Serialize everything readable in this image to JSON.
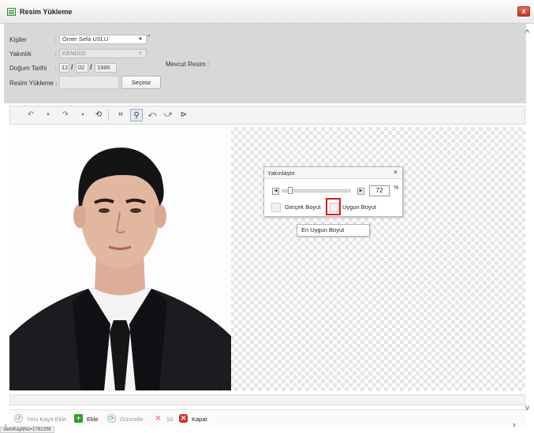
{
  "window": {
    "title": "Resim Yükleme",
    "close_glyph": "x"
  },
  "form": {
    "kisiler": {
      "label": "Kişiler",
      "value": "Ömer Sefa USLU",
      "required_mark": "*"
    },
    "yakinlik": {
      "label": "Yakınlık",
      "value": "KENDİSİ"
    },
    "dogum_tarihi": {
      "label": "Doğum Tarihi",
      "day": "12",
      "month": "02",
      "year": "1986"
    },
    "resim_yukleme": {
      "label": "Resim Yükleme :",
      "button": "Seçiniz"
    },
    "mevcut_resim_label": "Mevcut Resim :",
    "colon": ":"
  },
  "zoom_panel": {
    "title": "Yakınlaştır",
    "value": "72",
    "unit": "%",
    "real_size_label": "Gerçek Boyut",
    "fit_size_label": "Uygun Boyut",
    "slider_fraction": 0.12
  },
  "tooltip": {
    "text": "En Uygun Boyut"
  },
  "actions": [
    {
      "label": "Yeni Kayıt Ekle",
      "icon": "new-record-icon",
      "enabled": false
    },
    {
      "label": "Ekle",
      "icon": "plus-icon",
      "enabled": true
    },
    {
      "label": "Güncelle",
      "icon": "refresh-icon",
      "enabled": false
    },
    {
      "label": "Sil",
      "icon": "delete-x-icon",
      "enabled": false
    },
    {
      "label": "Kapat",
      "icon": "close-icon",
      "enabled": true
    }
  ],
  "status_text": "slemKayitNo=1761206",
  "colors": {
    "accent_red": "#e01818",
    "close_red": "#c0392b",
    "add_green": "#2e9e2e"
  }
}
